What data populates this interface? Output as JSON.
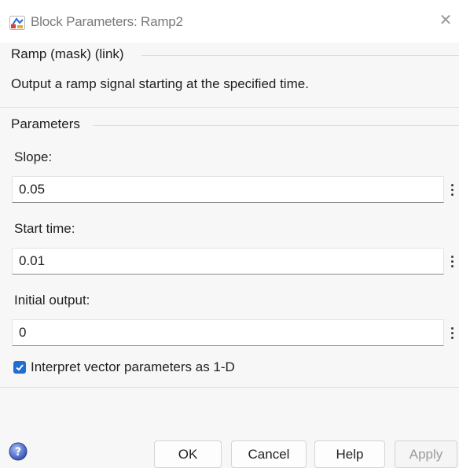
{
  "window": {
    "title": "Block Parameters: Ramp2",
    "close_glyph": "✕",
    "app_icon": "simulink-block-icon"
  },
  "block_group": {
    "label": "Ramp (mask) (link)",
    "description": "Output a ramp signal starting at the specified time."
  },
  "parameters": {
    "group_label": "Parameters",
    "slope": {
      "label": "Slope:",
      "value": "0.05"
    },
    "start_time": {
      "label": "Start time:",
      "value": "0.01"
    },
    "initial_output": {
      "label": "Initial output:",
      "value": "0"
    },
    "interpret_vector": {
      "label": "Interpret vector parameters as 1-D",
      "checked": true
    }
  },
  "buttons": {
    "ok": "OK",
    "cancel": "Cancel",
    "help": "Help",
    "apply": "Apply"
  },
  "colors": {
    "accent": "#1f6fd1",
    "help_icon": "#4a67c9"
  }
}
